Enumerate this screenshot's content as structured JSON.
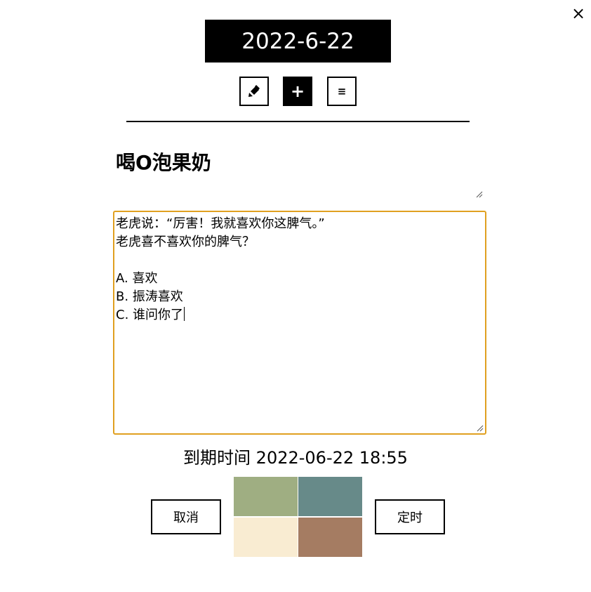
{
  "window": {
    "close_glyph": "×"
  },
  "header": {
    "date": "2022-6-22"
  },
  "toolbar": {
    "edit_icon": "pencil-icon",
    "edit_glyph": "✎",
    "add_icon": "plus-icon",
    "add_glyph": "+",
    "list_icon": "list-icon",
    "list_glyph": "≡"
  },
  "task": {
    "title": "喝O泡果奶",
    "content_lines": [
      "老虎说：“厉害！我就喜欢你这脾气。”",
      "老虎喜不喜欢你的脾气？",
      "",
      "A. 喜欢",
      "B. 振涛喜欢",
      "C. 谁问你了"
    ],
    "due_label": "到期时间",
    "due_value": "2022-06-22 18:55"
  },
  "actions": {
    "cancel_label": "取消",
    "timer_label": "定时"
  },
  "palette": {
    "colors": [
      "#9fae82",
      "#678a89",
      "#f9ecd2",
      "#a57c62"
    ]
  },
  "accent": {
    "focus_border": "#e0a020"
  }
}
